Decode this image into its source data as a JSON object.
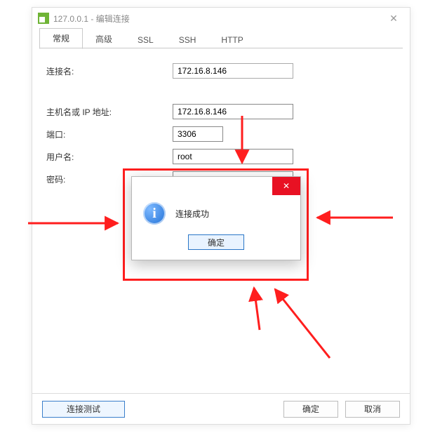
{
  "window": {
    "title": "127.0.0.1 - 编辑连接"
  },
  "tabs": {
    "general": "常规",
    "advanced": "高级",
    "ssl": "SSL",
    "ssh": "SSH",
    "http": "HTTP"
  },
  "form": {
    "labels": {
      "name": "连接名:",
      "host": "主机名或 IP 地址:",
      "port": "端口:",
      "user": "用户名:",
      "pass": "密码:"
    },
    "values": {
      "name": "172.16.8.146",
      "host": "172.16.8.146",
      "port": "3306",
      "user": "root",
      "pass": "•••••••"
    }
  },
  "buttons": {
    "test": "连接测试",
    "ok": "确定",
    "cancel": "取消"
  },
  "modal": {
    "message": "连接成功",
    "ok": "确定"
  }
}
